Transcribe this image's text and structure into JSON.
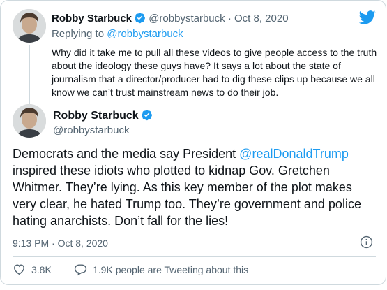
{
  "parent_tweet": {
    "name": "Robby Starbuck",
    "handle": "@robbystarbuck",
    "separator": "·",
    "date": "Oct 8, 2020",
    "replying_prefix": "Replying to",
    "replying_to": "@robbystarbuck",
    "text": "Why did it take me to pull all these videos to give people access to the truth about the ideology these guys have? It says a lot about the state of journalism that a director/producer had to dig these clips up because we all know we can’t trust mainstream news to do their job."
  },
  "main_tweet": {
    "name": "Robby Starbuck",
    "handle": "@robbystarbuck",
    "text_before": "Democrats and the media say President ",
    "mention": "@realDonaldTrump",
    "text_after": " inspired these idiots who plotted to kidnap Gov. Gretchen Whitmer. They’re lying. As this key member of the plot makes very clear, he hated Trump too. They’re government and police hating anarchists. Don’t fall for the lies!",
    "timestamp": "9:13 PM · Oct 8, 2020"
  },
  "actions": {
    "likes": "3.8K",
    "replies_label": "1.9K people are Tweeting about this"
  },
  "colors": {
    "accent": "#1d9bf0",
    "text": "#0f1419",
    "secondary": "#536471",
    "border": "#cfd9de"
  },
  "icons": [
    "twitter-bird-icon",
    "verified-badge-icon",
    "info-icon",
    "heart-icon",
    "reply-bubble-icon",
    "avatar"
  ]
}
